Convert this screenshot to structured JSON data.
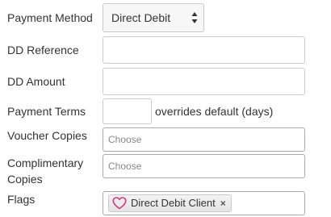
{
  "form": {
    "payment_method": {
      "label": "Payment Method",
      "selected": "Direct Debit"
    },
    "dd_reference": {
      "label": "DD Reference",
      "value": ""
    },
    "dd_amount": {
      "label": "DD Amount",
      "value": ""
    },
    "payment_terms": {
      "label": "Payment Terms",
      "value": "",
      "note": "overrides default (days)"
    },
    "voucher_copies": {
      "label": "Voucher Copies",
      "placeholder": "Choose"
    },
    "complimentary_copies": {
      "label_line1": "Complimentary",
      "label_line2": "Copies",
      "placeholder": "Choose"
    },
    "flags": {
      "label": "Flags",
      "tags": [
        {
          "label": "Direct Debit Client",
          "icon": "heart-icon",
          "remove": "×"
        }
      ]
    }
  },
  "colors": {
    "text": "#333333",
    "placeholder": "#888888",
    "border": "#cccccc",
    "heart": "#d6338a"
  }
}
